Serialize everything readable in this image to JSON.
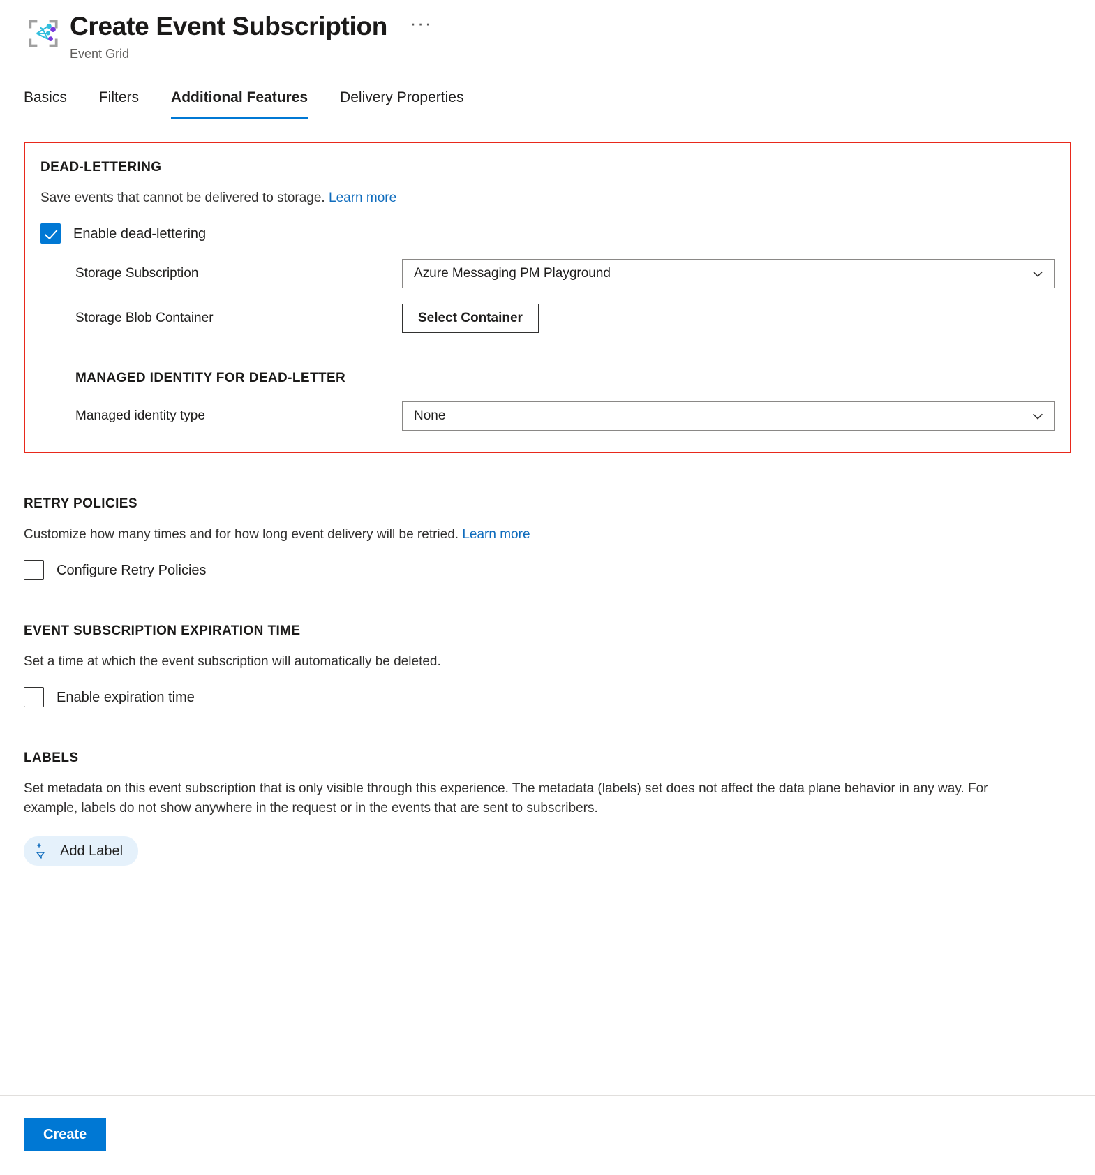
{
  "header": {
    "title": "Create Event Subscription",
    "subtitle": "Event Grid",
    "more_label": "···",
    "icon": "event-grid-icon"
  },
  "tabs": [
    {
      "label": "Basics",
      "active": false
    },
    {
      "label": "Filters",
      "active": false
    },
    {
      "label": "Additional Features",
      "active": true
    },
    {
      "label": "Delivery Properties",
      "active": false
    }
  ],
  "dead_lettering": {
    "heading": "DEAD-LETTERING",
    "description": "Save events that cannot be delivered to storage.",
    "learn_more": "Learn more",
    "enable_label": "Enable dead-lettering",
    "enable_checked": true,
    "storage_subscription": {
      "label": "Storage Subscription",
      "value": "Azure Messaging PM Playground"
    },
    "storage_blob_container": {
      "label": "Storage Blob Container",
      "button": "Select Container"
    },
    "managed_identity": {
      "heading": "MANAGED IDENTITY FOR DEAD-LETTER",
      "label": "Managed identity type",
      "value": "None"
    }
  },
  "retry_policies": {
    "heading": "RETRY POLICIES",
    "description": "Customize how many times and for how long event delivery will be retried.",
    "learn_more": "Learn more",
    "checkbox_label": "Configure Retry Policies",
    "checked": false
  },
  "expiration": {
    "heading": "EVENT SUBSCRIPTION EXPIRATION TIME",
    "description": "Set a time at which the event subscription will automatically be deleted.",
    "checkbox_label": "Enable expiration time",
    "checked": false
  },
  "labels": {
    "heading": "LABELS",
    "description": "Set metadata on this event subscription that is only visible through this experience. The metadata (labels) set does not affect the data plane behavior in any way. For example, labels do not show anywhere in the request or in the events that are sent to subscribers.",
    "add_label_button": "Add Label",
    "add_label_icon": "add-filter-icon"
  },
  "footer": {
    "create_button": "Create"
  },
  "colors": {
    "accent": "#0078d4",
    "highlight_border": "#e8291c",
    "link": "#0f6cbd",
    "pill_bg": "#e5f1fb"
  }
}
